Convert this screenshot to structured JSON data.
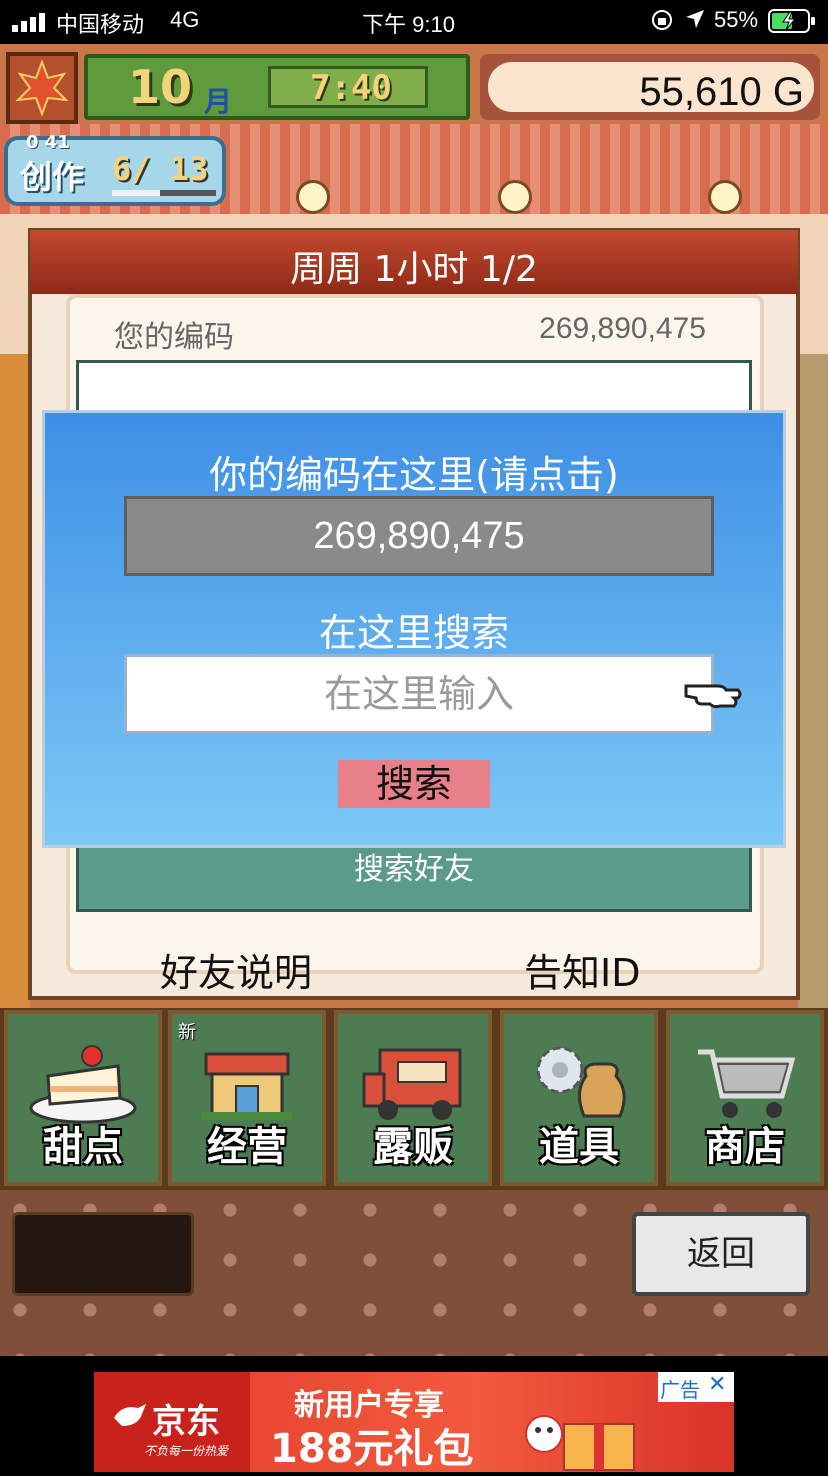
{
  "status_bar": {
    "carrier": "中国移动",
    "network": "4G",
    "time": "下午 9:10",
    "battery": "55%"
  },
  "hud": {
    "month_number": "10",
    "month_unit": "月",
    "clock": "7:40",
    "gold": "55,610 G"
  },
  "create_badge": {
    "label": "创作",
    "progress": "6/ 13",
    "timer": "0 41"
  },
  "panel": {
    "header": "周周  1小时 1/2",
    "your_code_label": "您的编码",
    "your_code_value": "269,890,475",
    "friend_button": "搜索好友",
    "friend_help": "好友说明",
    "notify_id": "告知ID"
  },
  "modal": {
    "code_prompt": "你的编码在这里(请点击)",
    "code_value": "269,890,475",
    "search_label": "在这里搜索",
    "search_placeholder": "在这里输入",
    "search_button": "搜索"
  },
  "menu": {
    "new_badge": "新",
    "items": [
      {
        "label": "甜点",
        "icon": "cake-icon"
      },
      {
        "label": "经营",
        "icon": "shop-building-icon"
      },
      {
        "label": "露贩",
        "icon": "food-truck-icon"
      },
      {
        "label": "道具",
        "icon": "gear-bag-icon"
      },
      {
        "label": "商店",
        "icon": "shopping-cart-icon"
      }
    ]
  },
  "return_button": "返回",
  "ad": {
    "brand": "京东",
    "slogan": "不负每一份热爱",
    "headline": "新用户专享",
    "offer": "188元礼包",
    "tag": "广告"
  }
}
